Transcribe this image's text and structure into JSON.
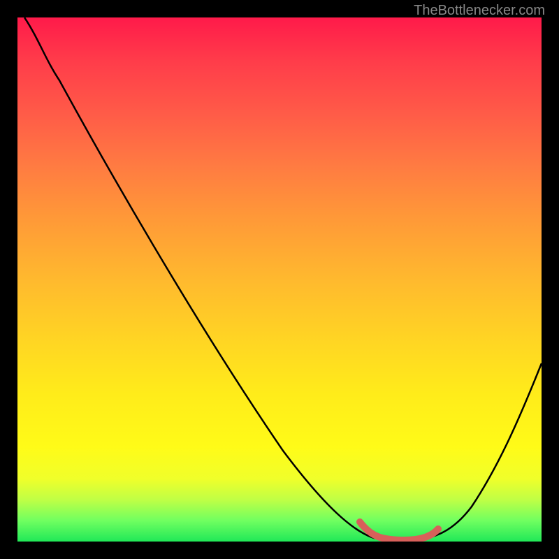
{
  "watermark": "TheBottlenecker.com",
  "chart_data": {
    "type": "line",
    "title": "",
    "xlabel": "",
    "ylabel": "",
    "xlim": [
      0,
      100
    ],
    "ylim": [
      0,
      100
    ],
    "series": [
      {
        "name": "bottleneck-curve",
        "x": [
          0,
          4,
          10,
          20,
          30,
          40,
          50,
          60,
          65,
          70,
          75,
          78,
          82,
          88,
          94,
          100
        ],
        "values": [
          100,
          97,
          92,
          80,
          67,
          53,
          40,
          26,
          18,
          10,
          4,
          1,
          0,
          5,
          18,
          34
        ]
      }
    ],
    "highlight": {
      "name": "optimal-range",
      "x": [
        65,
        70,
        74,
        78,
        80
      ],
      "values": [
        4,
        1.5,
        0.5,
        1,
        2.5
      ]
    },
    "gradient_stops": [
      {
        "pos": 0,
        "color": "#ff1a4a"
      },
      {
        "pos": 50,
        "color": "#ffb92e"
      },
      {
        "pos": 82,
        "color": "#fffb18"
      },
      {
        "pos": 100,
        "color": "#20e858"
      }
    ]
  }
}
